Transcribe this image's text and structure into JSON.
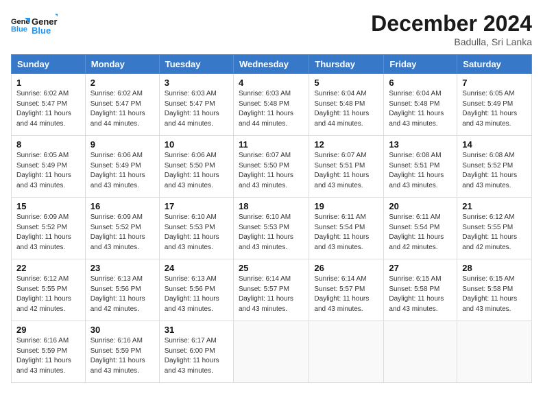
{
  "header": {
    "logo_line1": "General",
    "logo_line2": "Blue",
    "month_title": "December 2024",
    "location": "Badulla, Sri Lanka"
  },
  "weekdays": [
    "Sunday",
    "Monday",
    "Tuesday",
    "Wednesday",
    "Thursday",
    "Friday",
    "Saturday"
  ],
  "weeks": [
    [
      {
        "day": 1,
        "info": "Sunrise: 6:02 AM\nSunset: 5:47 PM\nDaylight: 11 hours and 44 minutes."
      },
      {
        "day": 2,
        "info": "Sunrise: 6:02 AM\nSunset: 5:47 PM\nDaylight: 11 hours and 44 minutes."
      },
      {
        "day": 3,
        "info": "Sunrise: 6:03 AM\nSunset: 5:47 PM\nDaylight: 11 hours and 44 minutes."
      },
      {
        "day": 4,
        "info": "Sunrise: 6:03 AM\nSunset: 5:48 PM\nDaylight: 11 hours and 44 minutes."
      },
      {
        "day": 5,
        "info": "Sunrise: 6:04 AM\nSunset: 5:48 PM\nDaylight: 11 hours and 44 minutes."
      },
      {
        "day": 6,
        "info": "Sunrise: 6:04 AM\nSunset: 5:48 PM\nDaylight: 11 hours and 43 minutes."
      },
      {
        "day": 7,
        "info": "Sunrise: 6:05 AM\nSunset: 5:49 PM\nDaylight: 11 hours and 43 minutes."
      }
    ],
    [
      {
        "day": 8,
        "info": "Sunrise: 6:05 AM\nSunset: 5:49 PM\nDaylight: 11 hours and 43 minutes."
      },
      {
        "day": 9,
        "info": "Sunrise: 6:06 AM\nSunset: 5:49 PM\nDaylight: 11 hours and 43 minutes."
      },
      {
        "day": 10,
        "info": "Sunrise: 6:06 AM\nSunset: 5:50 PM\nDaylight: 11 hours and 43 minutes."
      },
      {
        "day": 11,
        "info": "Sunrise: 6:07 AM\nSunset: 5:50 PM\nDaylight: 11 hours and 43 minutes."
      },
      {
        "day": 12,
        "info": "Sunrise: 6:07 AM\nSunset: 5:51 PM\nDaylight: 11 hours and 43 minutes."
      },
      {
        "day": 13,
        "info": "Sunrise: 6:08 AM\nSunset: 5:51 PM\nDaylight: 11 hours and 43 minutes."
      },
      {
        "day": 14,
        "info": "Sunrise: 6:08 AM\nSunset: 5:52 PM\nDaylight: 11 hours and 43 minutes."
      }
    ],
    [
      {
        "day": 15,
        "info": "Sunrise: 6:09 AM\nSunset: 5:52 PM\nDaylight: 11 hours and 43 minutes."
      },
      {
        "day": 16,
        "info": "Sunrise: 6:09 AM\nSunset: 5:52 PM\nDaylight: 11 hours and 43 minutes."
      },
      {
        "day": 17,
        "info": "Sunrise: 6:10 AM\nSunset: 5:53 PM\nDaylight: 11 hours and 43 minutes."
      },
      {
        "day": 18,
        "info": "Sunrise: 6:10 AM\nSunset: 5:53 PM\nDaylight: 11 hours and 43 minutes."
      },
      {
        "day": 19,
        "info": "Sunrise: 6:11 AM\nSunset: 5:54 PM\nDaylight: 11 hours and 43 minutes."
      },
      {
        "day": 20,
        "info": "Sunrise: 6:11 AM\nSunset: 5:54 PM\nDaylight: 11 hours and 42 minutes."
      },
      {
        "day": 21,
        "info": "Sunrise: 6:12 AM\nSunset: 5:55 PM\nDaylight: 11 hours and 42 minutes."
      }
    ],
    [
      {
        "day": 22,
        "info": "Sunrise: 6:12 AM\nSunset: 5:55 PM\nDaylight: 11 hours and 42 minutes."
      },
      {
        "day": 23,
        "info": "Sunrise: 6:13 AM\nSunset: 5:56 PM\nDaylight: 11 hours and 42 minutes."
      },
      {
        "day": 24,
        "info": "Sunrise: 6:13 AM\nSunset: 5:56 PM\nDaylight: 11 hours and 43 minutes."
      },
      {
        "day": 25,
        "info": "Sunrise: 6:14 AM\nSunset: 5:57 PM\nDaylight: 11 hours and 43 minutes."
      },
      {
        "day": 26,
        "info": "Sunrise: 6:14 AM\nSunset: 5:57 PM\nDaylight: 11 hours and 43 minutes."
      },
      {
        "day": 27,
        "info": "Sunrise: 6:15 AM\nSunset: 5:58 PM\nDaylight: 11 hours and 43 minutes."
      },
      {
        "day": 28,
        "info": "Sunrise: 6:15 AM\nSunset: 5:58 PM\nDaylight: 11 hours and 43 minutes."
      }
    ],
    [
      {
        "day": 29,
        "info": "Sunrise: 6:16 AM\nSunset: 5:59 PM\nDaylight: 11 hours and 43 minutes."
      },
      {
        "day": 30,
        "info": "Sunrise: 6:16 AM\nSunset: 5:59 PM\nDaylight: 11 hours and 43 minutes."
      },
      {
        "day": 31,
        "info": "Sunrise: 6:17 AM\nSunset: 6:00 PM\nDaylight: 11 hours and 43 minutes."
      },
      null,
      null,
      null,
      null
    ]
  ]
}
